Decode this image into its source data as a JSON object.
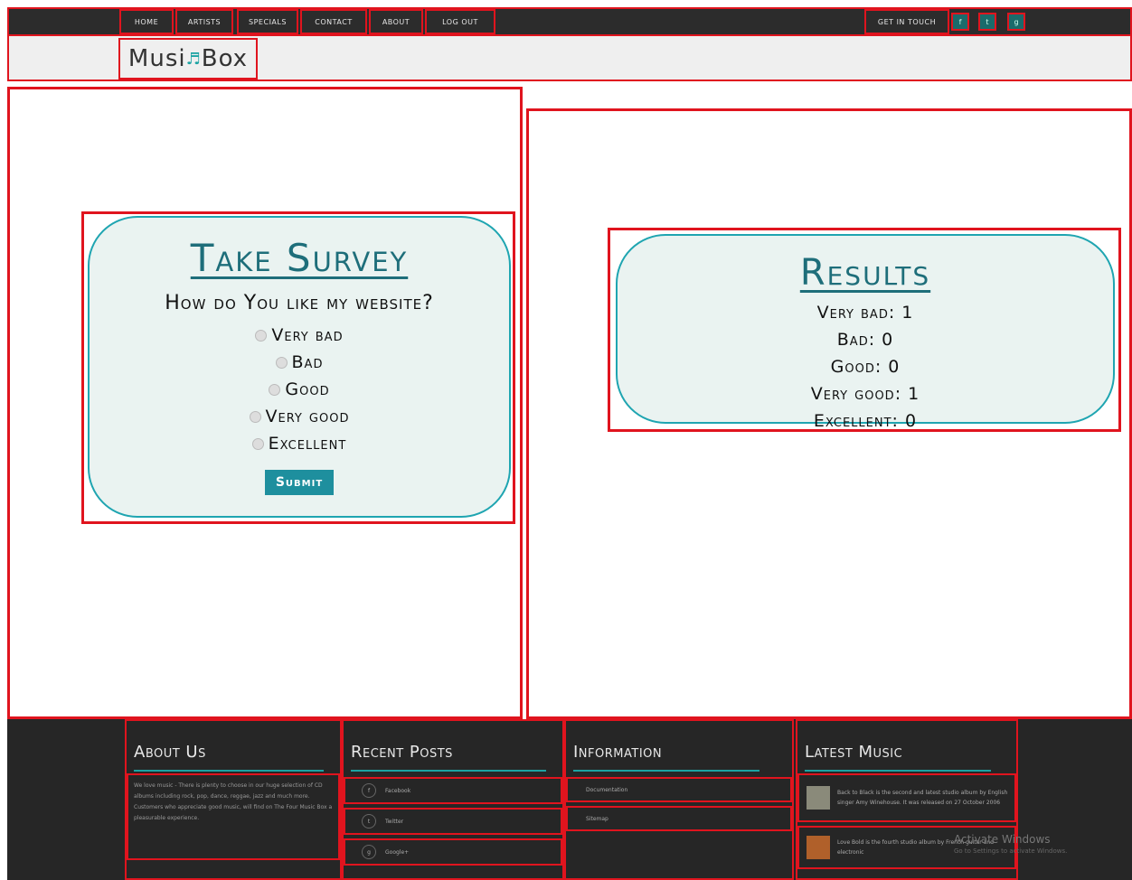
{
  "nav": {
    "items": [
      "HOME",
      "ARTISTS",
      "SPECIALS",
      "CONTACT",
      "ABOUT",
      "LOG OUT"
    ],
    "get_in_touch": "GET IN TOUCH",
    "social_icons": [
      "f",
      "t",
      "g"
    ]
  },
  "logo": {
    "text_left": "Musi",
    "note": "♬",
    "text_right": "Box"
  },
  "survey": {
    "title": "Take Survey",
    "question": "How do You like my website?",
    "options": [
      "Very bad",
      "Bad",
      "Good",
      "Very good",
      "Excellent"
    ],
    "submit_label": "Submit"
  },
  "results": {
    "title": "Results",
    "rows": [
      "Very bad: 1",
      "Bad: 0",
      "Good: 0",
      "Very good: 1",
      "Excellent: 0"
    ]
  },
  "footer": {
    "about": {
      "heading": "About Us",
      "text": "We love music - There is plenty to choose in our huge selection of CD albums including rock, pop, dance, reggae, jazz and much more. Customers who appreciate good music, will find on The Four Music Box a pleasurable experience."
    },
    "recent_posts": {
      "heading": "Recent Posts",
      "items": [
        {
          "icon": "f",
          "label": "Facebook"
        },
        {
          "icon": "t",
          "label": "Twitter"
        },
        {
          "icon": "g",
          "label": "Google+"
        }
      ]
    },
    "information": {
      "heading": "Information",
      "items": [
        "Documentation",
        "Sitemap"
      ]
    },
    "latest_music": {
      "heading": "Latest Music",
      "items": [
        "Back to Black is the second and latest studio album by English singer Amy Winehouse. It was released on 27 October 2006",
        "Love Bold is the fourth studio album by French guitar and electronic"
      ]
    }
  },
  "watermark": {
    "title": "Activate Windows",
    "subtitle": "Go to Settings to activate Windows."
  },
  "colors": {
    "accent": "#1ba3a3",
    "annotation": "#e0141e",
    "footer_bg": "#262626"
  }
}
